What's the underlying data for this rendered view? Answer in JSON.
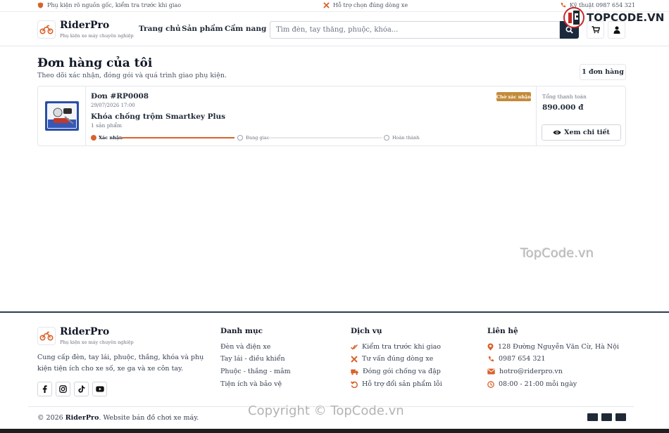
{
  "topbar": {
    "left": "Phụ kiện rõ nguồn gốc, kiểm tra trước khi giao",
    "center": "Hỗ trợ chọn đúng dòng xe",
    "right": "Kỹ thuật 0987 654 321"
  },
  "header": {
    "brand": "RiderPro",
    "tagline": "Phụ kiện xe máy chuyên nghiệp",
    "nav": [
      "Trang chủ",
      "Sản phẩm",
      "Cẩm nang"
    ],
    "search_placeholder": "Tìm đèn, tay thắng, phuộc, khóa..."
  },
  "page": {
    "title": "Đơn hàng của tôi",
    "subtitle": "Theo dõi xác nhận, đóng gói và quá trình giao phụ kiện.",
    "order_count": "1 đơn hàng"
  },
  "orders": [
    {
      "id": "Đơn #RP0008",
      "date": "29/07/2026 17:00",
      "product": "Khóa chống trộm Smartkey Plus",
      "quantity": "1 sản phẩm",
      "status": "Chờ xác nhận",
      "steps": [
        "Xác nhận",
        "Đang giao",
        "Hoàn thành"
      ],
      "progress_step": 1,
      "total_label": "Tổng thanh toán",
      "total": "890.000 đ",
      "detail_label": "Xem chi tiết"
    }
  ],
  "footer": {
    "brand": "RiderPro",
    "tagline": "Phụ kiện xe máy chuyên nghiệp",
    "description": "Cung cấp đèn, tay lái, phuộc, thắng, khóa và phụ kiện tiện ích cho xe số, xe ga và xe côn tay.",
    "categories_title": "Danh mục",
    "categories": [
      "Đèn và điện xe",
      "Tay lái - điều khiển",
      "Phuộc - thắng - mâm",
      "Tiện ích và bảo vệ"
    ],
    "services_title": "Dịch vụ",
    "services": [
      "Kiểm tra trước khi giao",
      "Tư vấn đúng dòng xe",
      "Đóng gói chống va đập",
      "Hỗ trợ đổi sản phẩm lỗi"
    ],
    "contact_title": "Liên hệ",
    "contact": [
      "128 Đường Nguyễn Văn Cừ, Hà Nội",
      "0987 654 321",
      "hotro@riderpro.vn",
      "08:00 - 21:00 mỗi ngày"
    ],
    "copyright_prefix": "© 2026 ",
    "copyright_brand": "RiderPro",
    "copyright_suffix": ". Website bán đồ chơi xe máy."
  },
  "watermarks": {
    "top": "TOPCODE.VN",
    "middle": "TopCode.vn",
    "bottom": "Copyright © TopCode.vn"
  },
  "colors": {
    "accent": "#d9622b",
    "dark": "#1b2a3d",
    "badge": "#c48a3a"
  }
}
